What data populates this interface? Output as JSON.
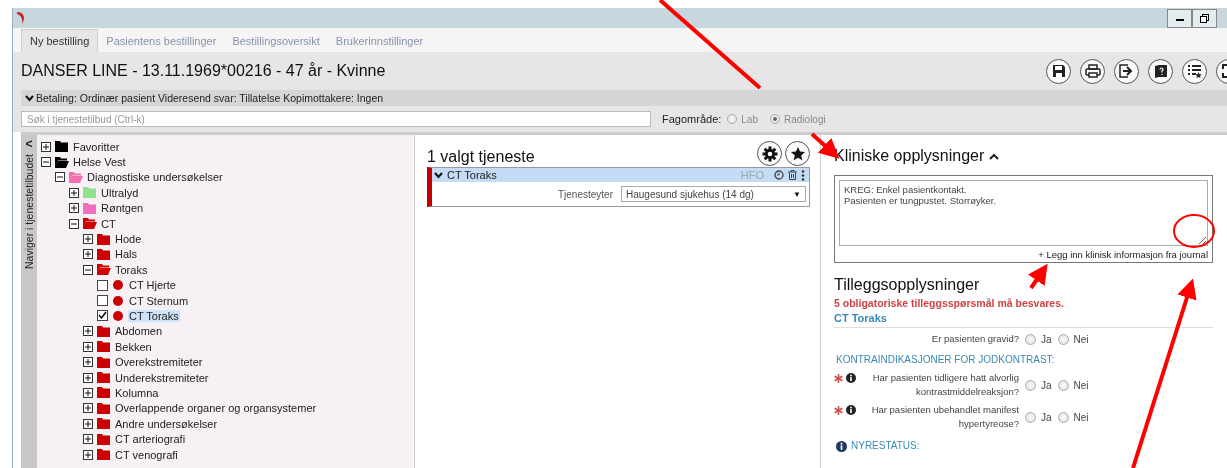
{
  "tabs": [
    {
      "label": "Ny bestilling",
      "selected": true
    },
    {
      "label": "Pasientens bestillinger",
      "selected": false
    },
    {
      "label": "Bestillingsoversikt",
      "selected": false
    },
    {
      "label": "Brukerinnstillinger",
      "selected": false
    }
  ],
  "patient": {
    "title": "DANSER LINE - 13.11.1969*00216 - 47 år - Kvinne"
  },
  "payment_bar": {
    "expanded": true,
    "text": "Betaling: Ordinær pasient Videresend svar: Tillatelse Kopimottakere: Ingen"
  },
  "search": {
    "placeholder": "Søk i tjenestetilbud (Ctrl-k)"
  },
  "fagomrade": {
    "label": "Fagområde:",
    "options": [
      {
        "label": "Lab",
        "selected": false
      },
      {
        "label": "Radiologi",
        "selected": true
      }
    ]
  },
  "sidebar": {
    "label": "Naviger i tjenestetilbudet",
    "collapse": "<"
  },
  "tree": [
    {
      "kind": "folder",
      "label": "Favoritter",
      "color": "#000000",
      "expanded": false
    },
    {
      "kind": "folder",
      "label": "Helse Vest",
      "color": "#000000",
      "expanded": true,
      "children": [
        {
          "kind": "folder",
          "label": "Diagnostiske undersøkelser",
          "color": "#f070b0",
          "expanded": true,
          "children": [
            {
              "kind": "folder",
              "label": "Ultralyd",
              "color": "#90e090",
              "expanded": false
            },
            {
              "kind": "folder",
              "label": "Røntgen",
              "color": "#f070c0",
              "expanded": false
            },
            {
              "kind": "folder",
              "label": "CT",
              "color": "#cc0000",
              "expanded": true,
              "children": [
                {
                  "kind": "folder",
                  "label": "Hode",
                  "color": "#cc0000",
                  "expanded": false
                },
                {
                  "kind": "folder",
                  "label": "Hals",
                  "color": "#cc0000",
                  "expanded": false
                },
                {
                  "kind": "folder",
                  "label": "Toraks",
                  "color": "#cc0000",
                  "expanded": true,
                  "children": [
                    {
                      "kind": "service",
                      "label": "CT Hjerte",
                      "color": "#cc0000",
                      "checked": false,
                      "selected": false
                    },
                    {
                      "kind": "service",
                      "label": "CT Sternum",
                      "color": "#cc0000",
                      "checked": false,
                      "selected": false
                    },
                    {
                      "kind": "service",
                      "label": "CT Toraks",
                      "color": "#cc0000",
                      "checked": true,
                      "selected": true
                    }
                  ]
                },
                {
                  "kind": "folder",
                  "label": "Abdomen",
                  "color": "#cc0000",
                  "expanded": false
                },
                {
                  "kind": "folder",
                  "label": "Bekken",
                  "color": "#cc0000",
                  "expanded": false
                },
                {
                  "kind": "folder",
                  "label": "Overekstremiteter",
                  "color": "#cc0000",
                  "expanded": false
                },
                {
                  "kind": "folder",
                  "label": "Underekstremiteter",
                  "color": "#cc0000",
                  "expanded": false
                },
                {
                  "kind": "folder",
                  "label": "Kolumna",
                  "color": "#cc0000",
                  "expanded": false
                },
                {
                  "kind": "folder",
                  "label": "Overlappende organer og organsystemer",
                  "color": "#cc0000",
                  "expanded": false
                },
                {
                  "kind": "folder",
                  "label": "Andre undersøkelser",
                  "color": "#cc0000",
                  "expanded": false
                },
                {
                  "kind": "folder",
                  "label": "CT arteriografi",
                  "color": "#cc0000",
                  "expanded": false
                },
                {
                  "kind": "folder",
                  "label": "CT venografi",
                  "color": "#cc0000",
                  "expanded": false
                }
              ]
            }
          ]
        }
      ]
    }
  ],
  "selected_services": {
    "title": "1 valgt tjeneste",
    "items": [
      {
        "name": "CT Toraks",
        "code": "HFO",
        "expanded": true,
        "provider_label": "Tjenesteyter",
        "provider": "Haugesund sjukehus (14 dg)",
        "caret": "▼"
      }
    ]
  },
  "clinical": {
    "title": "Kliniske opplysninger",
    "expanded": true,
    "value": "KREG: Enkel pasientkontakt.\nPasienten er tungpustet. Storrøyker.",
    "link": "+ Legg inn klinisk informasjon fra journal"
  },
  "additional": {
    "title": "Tilleggsopplysninger",
    "warning": "5 obligatoriske tilleggsspørsmål må besvares.",
    "service": "CT Toraks",
    "items": [
      {
        "kind": "question",
        "text": "Er pasienten gravid?",
        "options": [
          {
            "label": "Ja",
            "selected": false
          },
          {
            "label": "Nei",
            "selected": false
          }
        ]
      },
      {
        "kind": "heading",
        "text": "KONTRAINDIKASJONER FOR JODKONTRAST:"
      },
      {
        "kind": "question",
        "required": true,
        "info": true,
        "text": "Har pasienten tidligere hatt alvorlig kontrastmiddelreaksjon?",
        "options": [
          {
            "label": "Ja",
            "selected": false
          },
          {
            "label": "Nei",
            "selected": false
          }
        ]
      },
      {
        "kind": "question",
        "required": true,
        "info": true,
        "text": "Har pasienten ubehandlet manifest hypertyreose?",
        "options": [
          {
            "label": "Ja",
            "selected": false
          },
          {
            "label": "Nei",
            "selected": false
          }
        ]
      },
      {
        "kind": "heading",
        "info": true,
        "text": "NYRESTATUS:"
      }
    ]
  }
}
